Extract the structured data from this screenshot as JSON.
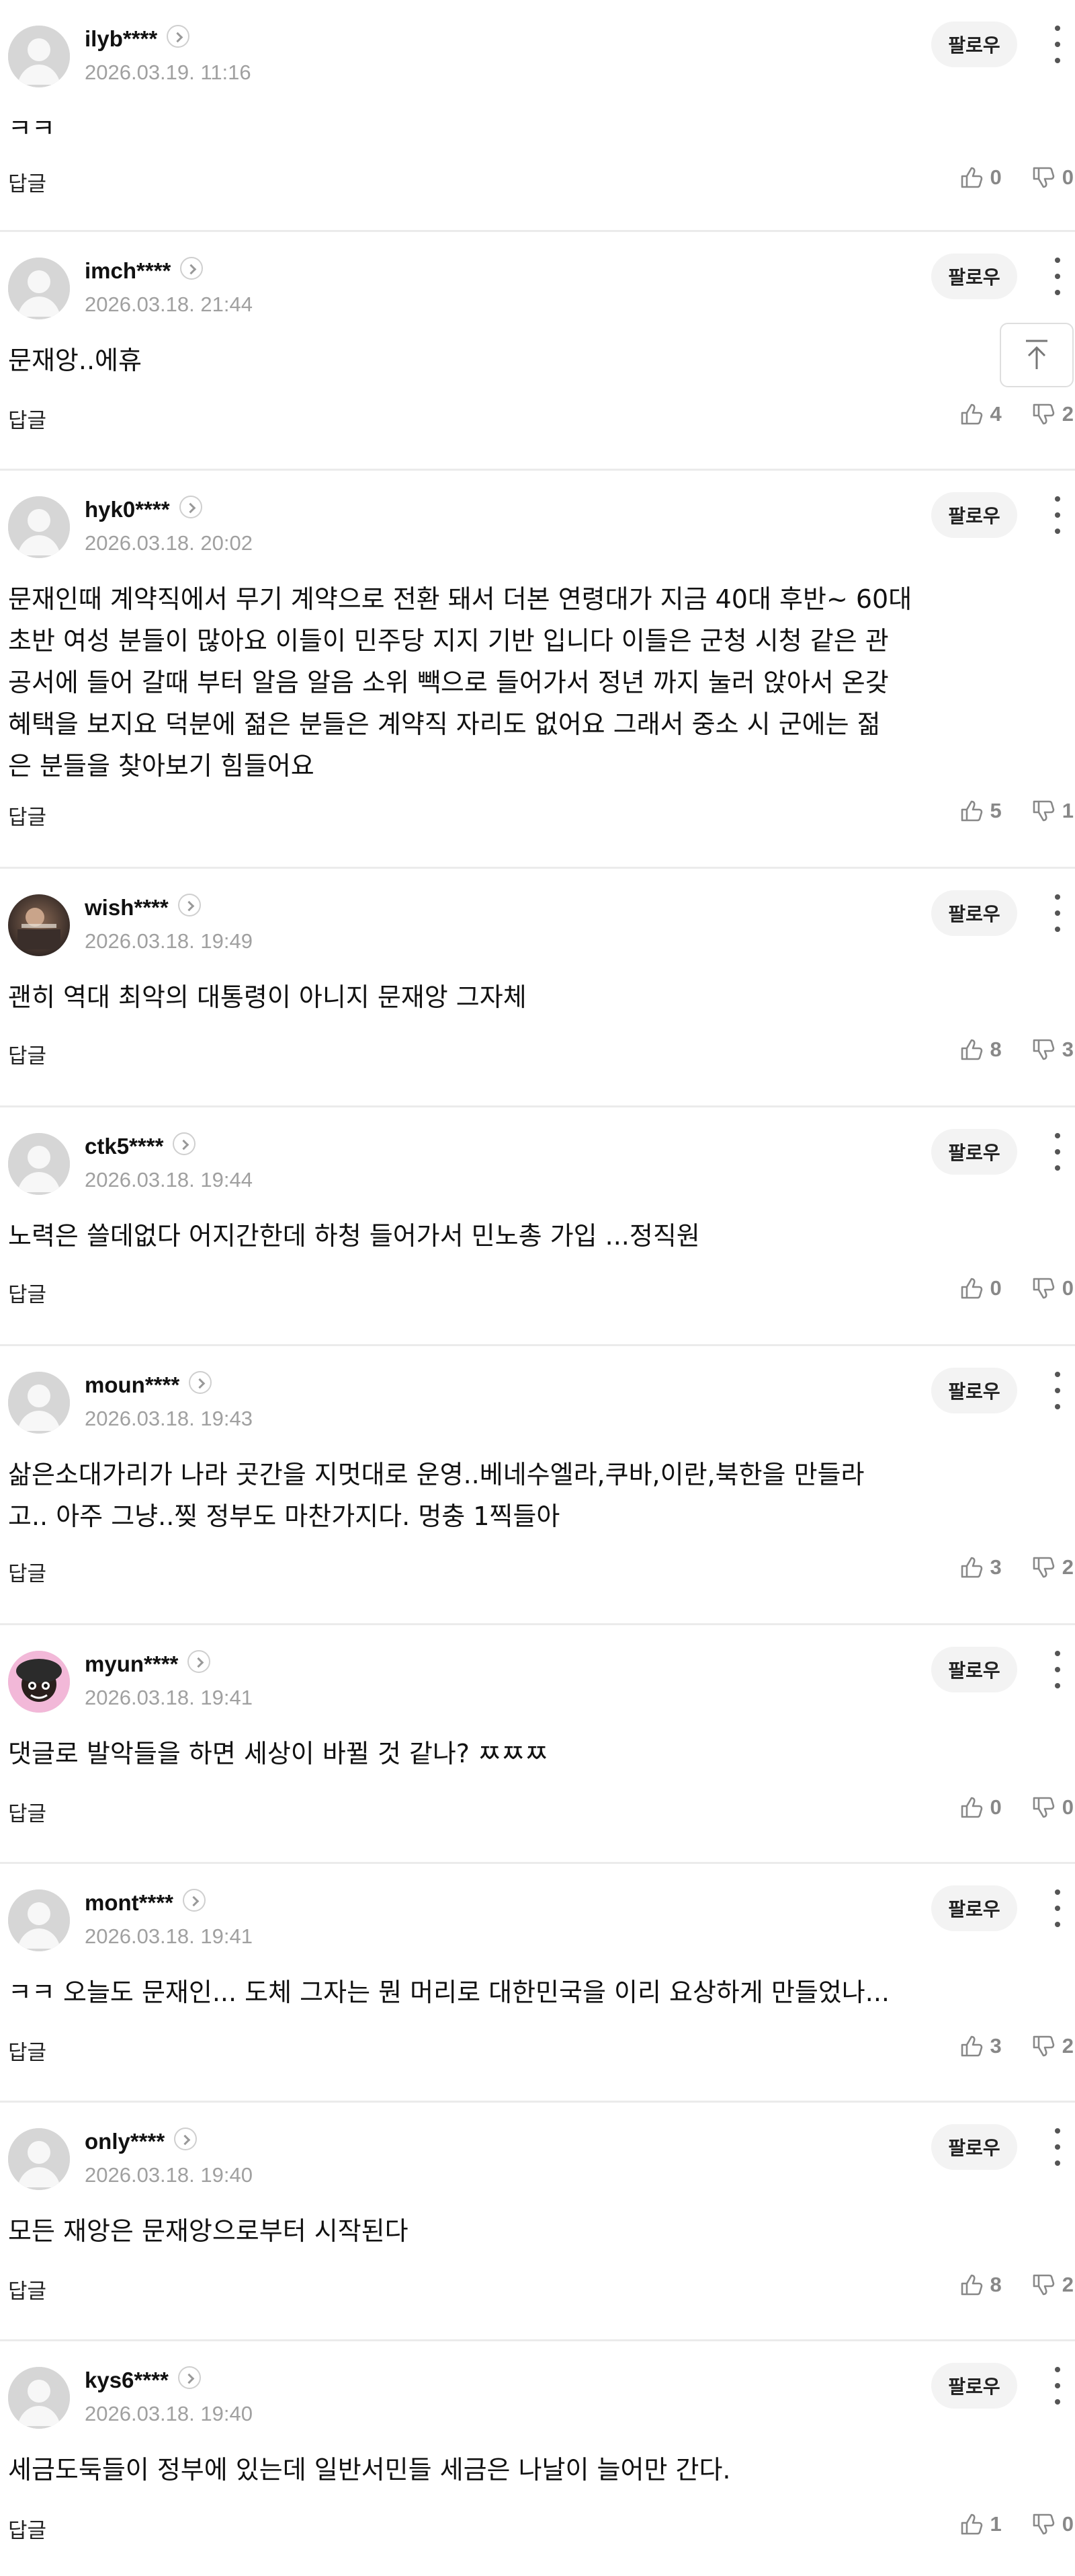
{
  "ui": {
    "follow_label": "팔로우",
    "reply_label": "답글"
  },
  "comments": [
    {
      "username": "ilyb****",
      "date": "2026.03.19. 11:16",
      "text": "ㅋㅋ",
      "likes": "0",
      "dislikes": "0",
      "avatar": "default-avatar"
    },
    {
      "username": "imch****",
      "date": "2026.03.18. 21:44",
      "text": "문재앙..에휴",
      "likes": "4",
      "dislikes": "2",
      "avatar": "default-avatar"
    },
    {
      "username": "hyk0****",
      "date": "2026.03.18. 20:02",
      "text": "문재인때 계약직에서 무기 계약으로 전환 돼서 더본 연령대가 지금 40대 후반~ 60대\n초반 여성 분들이 많아요 이들이 민주당 지지 기반 입니다 이들은 군청 시청 같은 관\n공서에 들어 갈때 부터 알음 알음 소위 빽으로 들어가서 정년 까지 눌러 앉아서 온갖\n혜택을 보지요 덕분에 젊은 분들은 계약직 자리도 없어요 그래서 중소 시 군에는 젊\n은 분들을 찾아보기 힘들어요",
      "likes": "5",
      "dislikes": "1",
      "avatar": "default-avatar"
    },
    {
      "username": "wish****",
      "date": "2026.03.18. 19:49",
      "text": "괜히 역대 최악의 대통령이 아니지 문재앙 그자체",
      "likes": "8",
      "dislikes": "3",
      "avatar": "photo-avatar"
    },
    {
      "username": "ctk5****",
      "date": "2026.03.18. 19:44",
      "text": "노력은 쓸데없다 어지간한데 하청 들어가서 민노총 가입 ...정직원",
      "likes": "0",
      "dislikes": "0",
      "avatar": "default-avatar"
    },
    {
      "username": "moun****",
      "date": "2026.03.18. 19:43",
      "text": "삶은소대가리가 나라 곳간을 지멋대로 운영..베네수엘라,쿠바,이란,북한을 만들라\n고.. 아주 그냥..찢 정부도 마찬가지다. 멍충 1찍들아",
      "likes": "3",
      "dislikes": "2",
      "avatar": "default-avatar"
    },
    {
      "username": "myun****",
      "date": "2026.03.18. 19:41",
      "text": "댓글로 발악들을 하면 세상이 바뀔 것 같나? ㅉㅉㅉ",
      "likes": "0",
      "dislikes": "0",
      "avatar": "cartoon-avatar"
    },
    {
      "username": "mont****",
      "date": "2026.03.18. 19:41",
      "text": "ㅋㅋ 오늘도 문재인... 도체 그자는 뭔 머리로 대한민국을 이리 요상하게 만들었나...",
      "likes": "3",
      "dislikes": "2",
      "avatar": "default-avatar"
    },
    {
      "username": "only****",
      "date": "2026.03.18. 19:40",
      "text": "모든 재앙은 문재앙으로부터 시작된다",
      "likes": "8",
      "dislikes": "2",
      "avatar": "default-avatar"
    },
    {
      "username": "kys6****",
      "date": "2026.03.18. 19:40",
      "text": "세금도둑들이 정부에 있는데 일반서민들 세금은 나날이 늘어만 간다.",
      "likes": "1",
      "dislikes": "0",
      "avatar": "default-avatar"
    }
  ],
  "icons": {
    "like": "thumbs-up-icon",
    "dislike": "thumbs-down-icon",
    "more": "more-vertical-icon",
    "top": "scroll-to-top-icon",
    "chevron": "chevron-right-icon"
  },
  "colors": {
    "divider": "#ebebeb",
    "muted": "#a0a0a0",
    "follow_bg": "#f3f3f3"
  }
}
